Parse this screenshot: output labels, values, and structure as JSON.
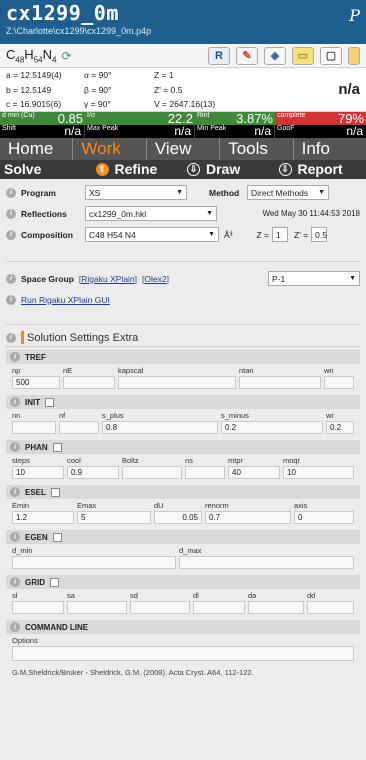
{
  "title": {
    "name": "cx1299_0m",
    "path": "Z:\\Charlotte\\cx1299\\cx1299_0m.p4p",
    "tag": "P"
  },
  "formula": {
    "text": "C48H54N4",
    "parts": [
      {
        "el": "C",
        "n": "48"
      },
      {
        "el": "H",
        "n": "54"
      },
      {
        "el": "N",
        "n": "4"
      }
    ]
  },
  "toolbar": {
    "icons": [
      "refresh-icon",
      "ron-icon",
      "pencil-icon",
      "palette-icon",
      "folder-icon",
      "window-icon",
      "expand-icon"
    ],
    "labels": {
      "ron": "R"
    }
  },
  "cell": {
    "a": "a = 12.5149(4)",
    "b": "b = 12.5149",
    "c": "c = 16.9015(6)",
    "alpha": "α = 90°",
    "beta": "β = 90°",
    "gamma": "γ = 90°",
    "Z": "Z = 1",
    "Zprime": "Z' = 0.5",
    "V": "V = 2647.16(13)",
    "na": "n/a"
  },
  "stats": [
    {
      "label": "d min (Cu)",
      "value": "0.85",
      "color": "#4a8a3a"
    },
    {
      "label": "I/σ",
      "value": "22.2",
      "color": "#4a8a3a"
    },
    {
      "label": "Rint",
      "value": "3.87%",
      "color": "#4a8a3a"
    },
    {
      "label": "complete",
      "value": "79%",
      "color": "#d33a3a"
    }
  ],
  "stats2": [
    {
      "label": "Shift",
      "value": "n/a"
    },
    {
      "label": "Max Peak",
      "value": "n/a"
    },
    {
      "label": "Min Peak",
      "value": "n/a"
    },
    {
      "label": "GooF",
      "value": "n/a"
    }
  ],
  "tabs": [
    "Home",
    "Work",
    "View",
    "Tools",
    "Info"
  ],
  "subtabs": [
    "Solve",
    "Refine",
    "Draw",
    "Report"
  ],
  "form": {
    "program_label": "Program",
    "program_value": "XS",
    "method_label": "Method",
    "method_value": "Direct Methods",
    "reflections_label": "Reflections",
    "reflections_value": "cx1299_0m.hkl",
    "reflections_date": "Wed May 30 11:44:53 2018",
    "composition_label": "Composition",
    "composition_value": "C48 H54 N4",
    "composition_unit": "Å³",
    "z_label": "Z =",
    "z_value": "1",
    "zprime_label": "Z' =",
    "zprime_value": "0.5",
    "spacegroup_label": "Space Group",
    "sg_link1": "[Rigaku XPlain]",
    "sg_link2": "[Olex2]",
    "spacegroup_value": "P-1",
    "run_link": "Run Rigaku XPlain GUI"
  },
  "settings": {
    "title": "Solution Settings Extra",
    "groups": [
      {
        "name": "TREF",
        "check": false,
        "fields": [
          {
            "l": "np",
            "v": "500"
          },
          {
            "l": "nE",
            "v": ""
          },
          {
            "l": "kapscal",
            "v": ""
          },
          {
            "l": "ntan",
            "v": ""
          },
          {
            "l": "wn",
            "v": ""
          }
        ]
      },
      {
        "name": "INIT",
        "check": true,
        "fields": [
          {
            "l": "nn",
            "v": ""
          },
          {
            "l": "nf",
            "v": ""
          },
          {
            "l": "s_plus",
            "v": "0.8"
          },
          {
            "l": "s_minus",
            "v": "0.2"
          },
          {
            "l": "wr",
            "v": "0.2"
          }
        ]
      },
      {
        "name": "PHAN",
        "check": true,
        "fields": [
          {
            "l": "steps",
            "v": "10"
          },
          {
            "l": "cool",
            "v": "0.9"
          },
          {
            "l": "Boltz",
            "v": ""
          },
          {
            "l": "ns",
            "v": ""
          },
          {
            "l": "mtpr",
            "v": "40"
          },
          {
            "l": "mnqr",
            "v": "10"
          }
        ]
      },
      {
        "name": "ESEL",
        "check": true,
        "fields": [
          {
            "l": "Emin",
            "v": "1.2"
          },
          {
            "l": "Emax",
            "v": "5"
          },
          {
            "l": "dU",
            "v": "0.05"
          },
          {
            "l": "renorm",
            "v": "0.7"
          },
          {
            "l": "axis",
            "v": "0"
          }
        ]
      },
      {
        "name": "EGEN",
        "check": true,
        "fields": [
          {
            "l": "d_min",
            "v": ""
          },
          {
            "l": "d_max",
            "v": ""
          }
        ]
      },
      {
        "name": "GRID",
        "check": true,
        "fields": [
          {
            "l": "sl",
            "v": ""
          },
          {
            "l": "sa",
            "v": ""
          },
          {
            "l": "sd",
            "v": ""
          },
          {
            "l": "dl",
            "v": ""
          },
          {
            "l": "da",
            "v": ""
          },
          {
            "l": "dd",
            "v": ""
          }
        ]
      },
      {
        "name": "COMMAND LINE",
        "check": false,
        "fields": [
          {
            "l": "Options",
            "v": ""
          }
        ]
      }
    ],
    "citation": "G.M.Sheldrick/Bruker - Sheldrick, G.M. (2008). Acta Cryst. A64, 112-122."
  }
}
